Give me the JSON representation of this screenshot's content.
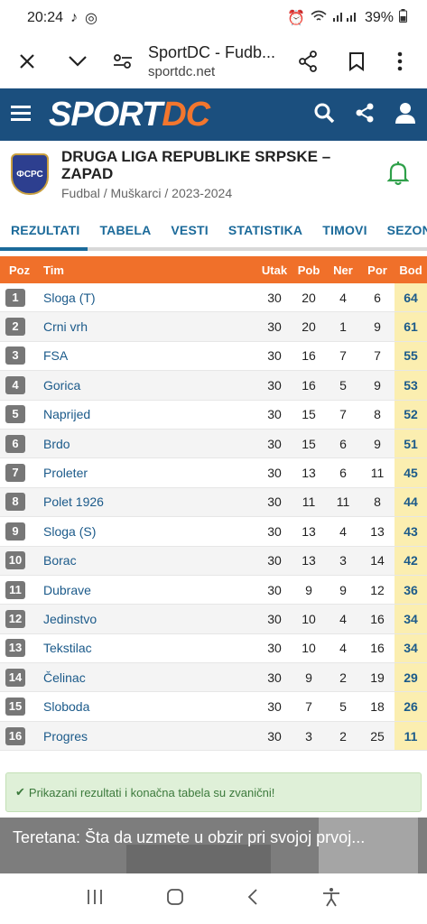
{
  "status": {
    "time": "20:24",
    "battery": "39%"
  },
  "browser": {
    "title": "SportDC - Fudb...",
    "url": "sportdc.net"
  },
  "site": {
    "logo_sport": "SPORT",
    "logo_dc": "DC"
  },
  "league": {
    "title": "DRUGA LIGA REPUBLIKE SRPSKE – ZAPAD",
    "subtitle": "Fudbal / Muškarci / 2023-2024",
    "crest_text": "ФСРС"
  },
  "tabs": [
    "REZULTATI",
    "TABELA",
    "VESTI",
    "STATISTIKA",
    "TIMOVI",
    "SEZONA:"
  ],
  "table": {
    "headers": {
      "poz": "Poz",
      "tim": "Tim",
      "utak": "Utak",
      "pob": "Pob",
      "ner": "Ner",
      "por": "Por",
      "bod": "Bod"
    },
    "rows": [
      {
        "poz": "1",
        "tim": "Sloga (T)",
        "utak": "30",
        "pob": "20",
        "ner": "4",
        "por": "6",
        "bod": "64"
      },
      {
        "poz": "2",
        "tim": "Crni vrh",
        "utak": "30",
        "pob": "20",
        "ner": "1",
        "por": "9",
        "bod": "61"
      },
      {
        "poz": "3",
        "tim": "FSA",
        "utak": "30",
        "pob": "16",
        "ner": "7",
        "por": "7",
        "bod": "55"
      },
      {
        "poz": "4",
        "tim": "Gorica",
        "utak": "30",
        "pob": "16",
        "ner": "5",
        "por": "9",
        "bod": "53"
      },
      {
        "poz": "5",
        "tim": "Naprijed",
        "utak": "30",
        "pob": "15",
        "ner": "7",
        "por": "8",
        "bod": "52"
      },
      {
        "poz": "6",
        "tim": "Brdo",
        "utak": "30",
        "pob": "15",
        "ner": "6",
        "por": "9",
        "bod": "51"
      },
      {
        "poz": "7",
        "tim": "Proleter",
        "utak": "30",
        "pob": "13",
        "ner": "6",
        "por": "11",
        "bod": "45"
      },
      {
        "poz": "8",
        "tim": "Polet 1926",
        "utak": "30",
        "pob": "11",
        "ner": "11",
        "por": "8",
        "bod": "44"
      },
      {
        "poz": "9",
        "tim": "Sloga (S)",
        "utak": "30",
        "pob": "13",
        "ner": "4",
        "por": "13",
        "bod": "43"
      },
      {
        "poz": "10",
        "tim": "Borac",
        "utak": "30",
        "pob": "13",
        "ner": "3",
        "por": "14",
        "bod": "42"
      },
      {
        "poz": "11",
        "tim": "Dubrave",
        "utak": "30",
        "pob": "9",
        "ner": "9",
        "por": "12",
        "bod": "36"
      },
      {
        "poz": "12",
        "tim": "Jedinstvo",
        "utak": "30",
        "pob": "10",
        "ner": "4",
        "por": "16",
        "bod": "34"
      },
      {
        "poz": "13",
        "tim": "Tekstilac",
        "utak": "30",
        "pob": "10",
        "ner": "4",
        "por": "16",
        "bod": "34"
      },
      {
        "poz": "14",
        "tim": "Čelinac",
        "utak": "30",
        "pob": "9",
        "ner": "2",
        "por": "19",
        "bod": "29"
      },
      {
        "poz": "15",
        "tim": "Sloboda",
        "utak": "30",
        "pob": "7",
        "ner": "5",
        "por": "18",
        "bod": "26"
      },
      {
        "poz": "16",
        "tim": "Progres",
        "utak": "30",
        "pob": "3",
        "ner": "2",
        "por": "25",
        "bod": "11"
      }
    ]
  },
  "notice": "Prikazani rezultati i konačna tabela su zvanični!",
  "article": {
    "title": "Teretana: Šta da uzmete u obzir pri svojoj prvoj..."
  },
  "colors": {
    "header_bg": "#1b4f7e",
    "accent": "#f0702a",
    "points_bg": "#fbeeb0"
  }
}
